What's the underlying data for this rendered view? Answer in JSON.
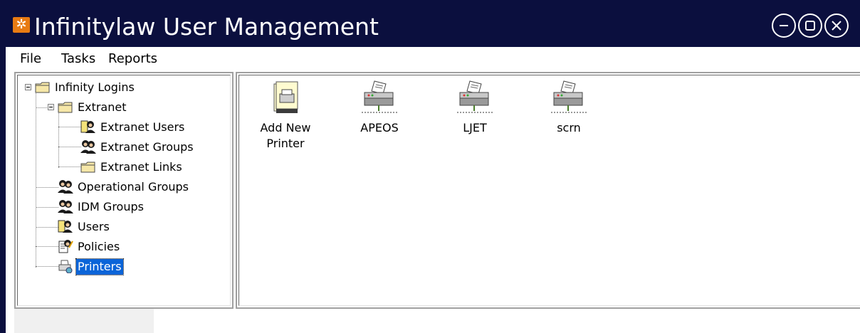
{
  "window": {
    "title": "Infinitylaw User Management",
    "accent_color": "#0b0f3e",
    "app_icon": "gear-icon",
    "controls": [
      "minimize-icon",
      "maximize-icon",
      "close-icon"
    ]
  },
  "menu": {
    "items": [
      {
        "label": "File"
      },
      {
        "label": "Tasks"
      },
      {
        "label": "Reports"
      }
    ]
  },
  "tree": {
    "nodes": [
      {
        "label": "Infinity Logins",
        "icon": "folder-icon",
        "expanded": true
      },
      {
        "label": "Extranet",
        "icon": "folder-icon",
        "expanded": true
      },
      {
        "label": "Extranet Users",
        "icon": "user-icon"
      },
      {
        "label": "Extranet Groups",
        "icon": "group-icon"
      },
      {
        "label": "Extranet Links",
        "icon": "folder-icon"
      },
      {
        "label": "Operational Groups",
        "icon": "group-icon"
      },
      {
        "label": "IDM Groups",
        "icon": "group-icon"
      },
      {
        "label": "Users",
        "icon": "user-icon"
      },
      {
        "label": "Policies",
        "icon": "policy-icon"
      },
      {
        "label": "Printers",
        "icon": "printers-icon",
        "selected": true
      }
    ]
  },
  "printers": {
    "items": [
      {
        "label_line1": "Add New",
        "label_line2": "Printer",
        "icon": "add-printer-icon"
      },
      {
        "label_line1": "APEOS",
        "label_line2": "",
        "icon": "network-printer-icon"
      },
      {
        "label_line1": "LJET",
        "label_line2": "",
        "icon": "network-printer-icon"
      },
      {
        "label_line1": "scrn",
        "label_line2": "",
        "icon": "network-printer-icon"
      }
    ]
  }
}
